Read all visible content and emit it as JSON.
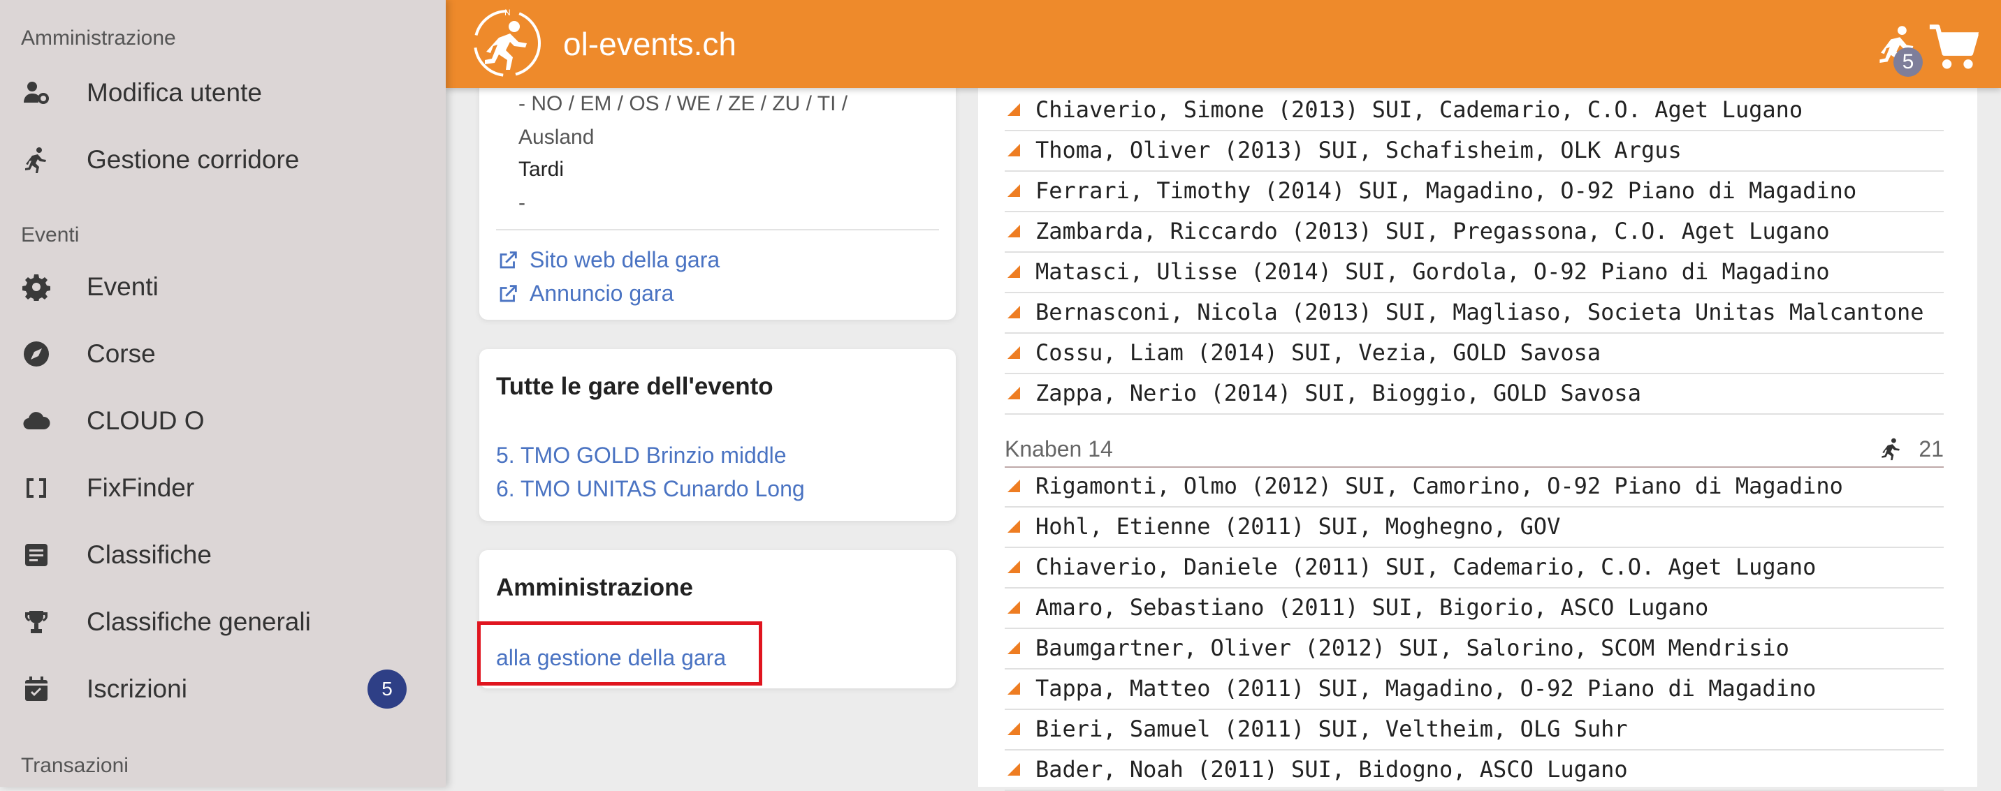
{
  "sidebar": {
    "section_admin": "Amministrazione",
    "admin_items": [
      {
        "label": "Modifica utente",
        "icon": "user-gear-icon"
      },
      {
        "label": "Gestione corridore",
        "icon": "runner-icon"
      }
    ],
    "section_events": "Eventi",
    "event_items": [
      {
        "label": "Eventi",
        "icon": "gear-icon"
      },
      {
        "label": "Corse",
        "icon": "compass-icon"
      },
      {
        "label": "CLOUD O",
        "icon": "cloud-icon"
      },
      {
        "label": "FixFinder",
        "icon": "brackets-icon"
      },
      {
        "label": "Classifiche",
        "icon": "list-icon"
      },
      {
        "label": "Classifiche generali",
        "icon": "trophy-icon"
      },
      {
        "label": "Iscrizioni",
        "icon": "calendar-check-icon",
        "badge": "5"
      }
    ],
    "section_transactions": "Transazioni"
  },
  "header": {
    "brand": "ol-events.ch",
    "runner_badge": "5",
    "accent_color": "#ee8a2b"
  },
  "info_card": {
    "regions": "- NO / EM / OS / WE / ZE / ZU / TI /",
    "regions_cont": "Ausland",
    "label_late": "Tardi",
    "value_late": "-",
    "link_website": "Sito web della gara",
    "link_announcement": "Annuncio gara"
  },
  "all_races_card": {
    "title": "Tutte le gare dell'evento",
    "links": [
      "5. TMO GOLD Brinzio middle",
      "6. TMO UNITAS Cunardo Long"
    ]
  },
  "admin_card": {
    "title": "Amministrazione",
    "link": "alla gestione della gara"
  },
  "results": {
    "rows_top": [
      "Chiaverio, Simone (2013) SUI, Cademario, C.O. Aget Lugano",
      "Thoma, Oliver (2013) SUI, Schafisheim, OLK Argus",
      "Ferrari, Timothy (2014) SUI, Magadino, O-92 Piano di Magadino",
      "Zambarda, Riccardo (2013) SUI, Pregassona, C.O. Aget Lugano",
      "Matasci, Ulisse (2014) SUI, Gordola, O-92 Piano di Magadino",
      "Bernasconi, Nicola (2013) SUI, Magliaso, Societa Unitas Malcantone",
      "Cossu, Liam (2014) SUI, Vezia, GOLD Savosa",
      "Zappa, Nerio (2014) SUI, Bioggio, GOLD Savosa"
    ],
    "category": {
      "name": "Knaben 14",
      "count": "21"
    },
    "rows_bottom": [
      "Rigamonti, Olmo (2012) SUI, Camorino, O-92 Piano di Magadino",
      "Hohl, Etienne (2011) SUI, Moghegno, GOV",
      "Chiaverio, Daniele (2011) SUI, Cademario, C.O. Aget Lugano",
      "Amaro, Sebastiano (2011) SUI, Bigorio, ASCO Lugano",
      "Baumgartner, Oliver (2012) SUI, Salorino, SCOM Mendrisio",
      "Tappa, Matteo (2011) SUI, Magadino, O-92 Piano di Magadino",
      "Bieri, Samuel (2011) SUI, Veltheim, OLG Suhr",
      "Bader, Noah (2011) SUI, Bidogno, ASCO Lugano"
    ]
  }
}
